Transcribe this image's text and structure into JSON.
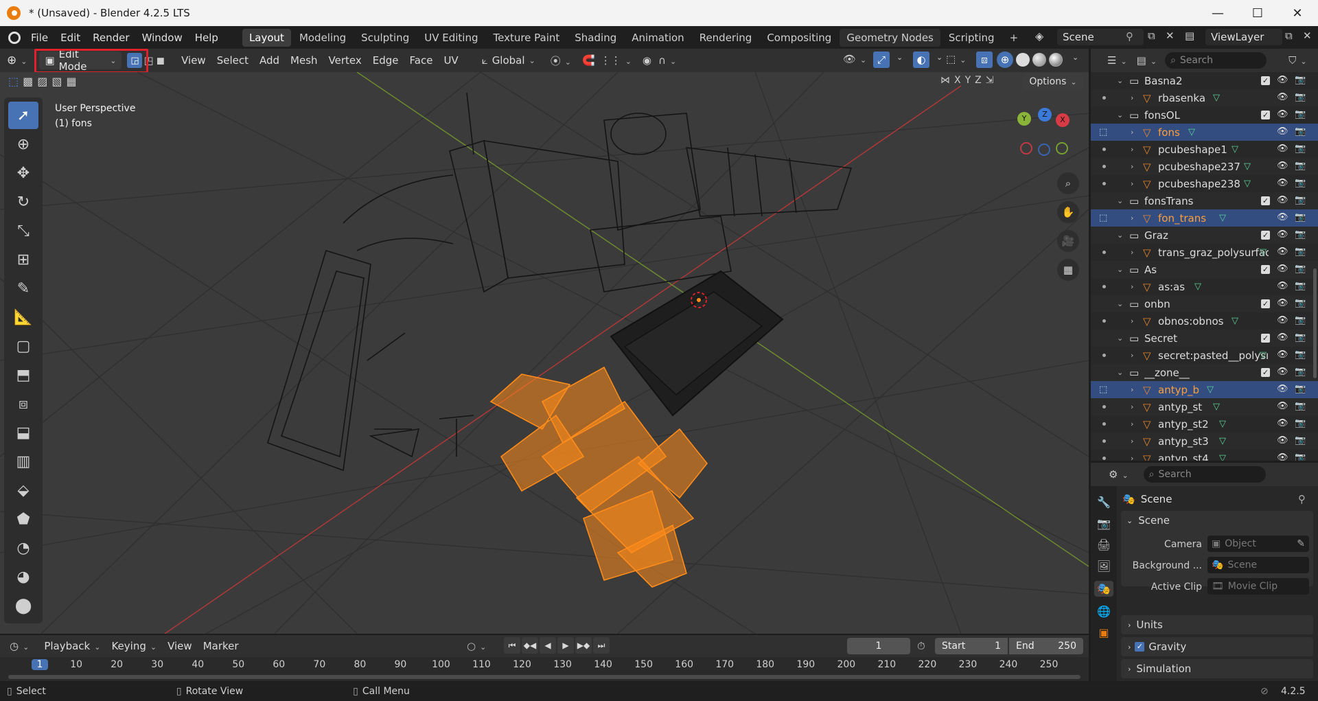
{
  "window": {
    "title": "* (Unsaved) - Blender 4.2.5 LTS",
    "minimize": "—",
    "maximize": "☐",
    "close": "✕"
  },
  "menu": [
    "File",
    "Edit",
    "Render",
    "Window",
    "Help"
  ],
  "workspaces": [
    "Layout",
    "Modeling",
    "Sculpting",
    "UV Editing",
    "Texture Paint",
    "Shading",
    "Animation",
    "Rendering",
    "Compositing",
    "Geometry Nodes",
    "Scripting",
    "+"
  ],
  "active_workspace": "Layout",
  "scene_name": "Scene",
  "view_layer": "ViewLayer",
  "viewport_header": {
    "mode": "Edit Mode",
    "menus": [
      "View",
      "Select",
      "Add",
      "Mesh",
      "Vertex",
      "Edge",
      "Face",
      "UV"
    ],
    "transform_orientation": "Global",
    "options_label": "Options",
    "axes": [
      "X",
      "Y",
      "Z"
    ]
  },
  "viewport": {
    "perspective_label": "User Perspective",
    "object_label": "(1) fons",
    "gizmo": {
      "x": "X",
      "y": "Y",
      "z": "Z"
    }
  },
  "toolbar": [
    "select-box-tool",
    "cursor-tool",
    "move-tool",
    "rotate-tool",
    "scale-tool",
    "transform-tool",
    "annotate-tool",
    "measure-tool",
    "add-cube-tool",
    "extrude-tool",
    "inset-tool",
    "bevel-tool",
    "loop-cut-tool",
    "knife-tool",
    "poly-build-tool",
    "spin-tool",
    "smooth-tool",
    "shrink-fatten-tool",
    "shear-tool"
  ],
  "outliner": {
    "search_placeholder": "Search",
    "rows": [
      {
        "label": "Basna2",
        "type": "collection",
        "indent": 1,
        "sel": false
      },
      {
        "label": "rbasenka",
        "type": "mesh",
        "indent": 2,
        "sel": false
      },
      {
        "label": "fonsOL",
        "type": "collection",
        "indent": 1,
        "sel": false
      },
      {
        "label": "fons",
        "type": "mesh",
        "indent": 2,
        "sel": true
      },
      {
        "label": "pcubeshape1",
        "type": "mesh",
        "indent": 2,
        "sel": false
      },
      {
        "label": "pcubeshape237",
        "type": "mesh",
        "indent": 2,
        "sel": false
      },
      {
        "label": "pcubeshape238",
        "type": "mesh",
        "indent": 2,
        "sel": false
      },
      {
        "label": "fonsTrans",
        "type": "collection",
        "indent": 1,
        "sel": false
      },
      {
        "label": "fon_trans",
        "type": "mesh",
        "indent": 2,
        "sel": true
      },
      {
        "label": "Graz",
        "type": "collection",
        "indent": 1,
        "sel": false
      },
      {
        "label": "trans_graz_polysurfac",
        "type": "mesh",
        "indent": 2,
        "sel": false
      },
      {
        "label": "As",
        "type": "collection",
        "indent": 1,
        "sel": false
      },
      {
        "label": "as:as",
        "type": "mesh",
        "indent": 2,
        "sel": false
      },
      {
        "label": "onbn",
        "type": "collection",
        "indent": 1,
        "sel": false
      },
      {
        "label": "obnos:obnos",
        "type": "mesh",
        "indent": 2,
        "sel": false
      },
      {
        "label": "Secret",
        "type": "collection",
        "indent": 1,
        "sel": false
      },
      {
        "label": "secret:pasted__polysı",
        "type": "mesh",
        "indent": 2,
        "sel": false
      },
      {
        "label": "__zone__",
        "type": "collection",
        "indent": 1,
        "sel": false
      },
      {
        "label": "antyp_b",
        "type": "mesh",
        "indent": 2,
        "sel": true
      },
      {
        "label": "antyp_st",
        "type": "mesh",
        "indent": 2,
        "sel": false
      },
      {
        "label": "antyp_st2",
        "type": "mesh",
        "indent": 2,
        "sel": false
      },
      {
        "label": "antyp_st3",
        "type": "mesh",
        "indent": 2,
        "sel": false
      },
      {
        "label": "antyp_st4",
        "type": "mesh",
        "indent": 2,
        "sel": false
      }
    ]
  },
  "properties": {
    "search_placeholder": "Search",
    "context": "Scene",
    "panel_scene": "Scene",
    "camera_label": "Camera",
    "camera_placeholder": "Object",
    "background_label": "Background ...",
    "background_placeholder": "Scene",
    "active_clip_label": "Active Clip",
    "active_clip_placeholder": "Movie Clip",
    "units": "Units",
    "gravity": "Gravity",
    "simulation": "Simulation"
  },
  "timeline": {
    "menus": [
      "Playback",
      "Keying",
      "View",
      "Marker"
    ],
    "current_frame": "1",
    "start_label": "Start",
    "start_value": "1",
    "end_label": "End",
    "end_value": "250",
    "ruler": [
      "1",
      "10",
      "20",
      "30",
      "40",
      "50",
      "60",
      "70",
      "80",
      "90",
      "100",
      "110",
      "120",
      "130",
      "140",
      "150",
      "160",
      "170",
      "180",
      "190",
      "200",
      "210",
      "220",
      "230",
      "240",
      "250"
    ]
  },
  "statusbar": {
    "select": "Select",
    "rotate": "Rotate View",
    "call_menu": "Call Menu",
    "version": "4.2.5"
  },
  "colors": {
    "accent": "#4772b3",
    "selection_orange": "#ff8c1a",
    "highlight_red": "#e0202a"
  }
}
